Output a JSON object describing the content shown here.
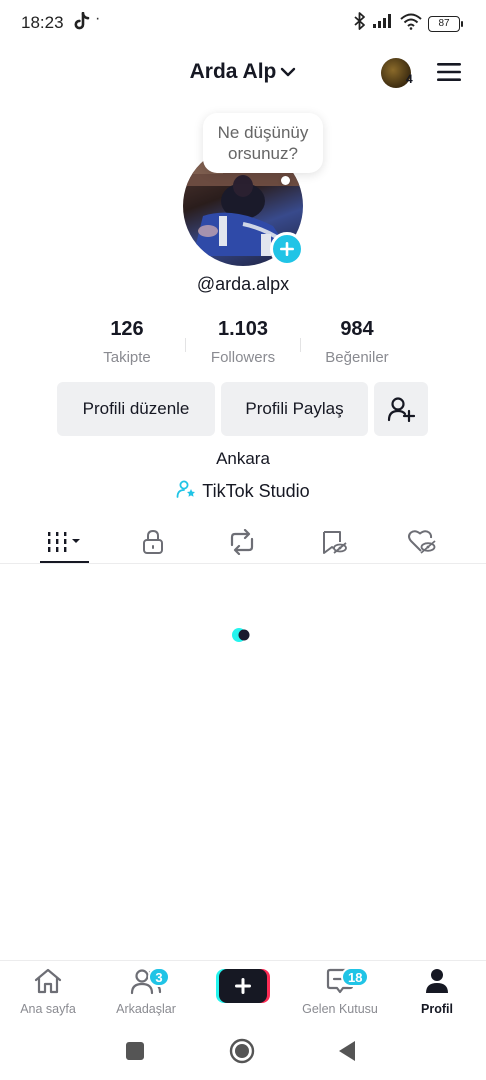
{
  "status_bar": {
    "time": "18:23",
    "dot": "·",
    "battery": "87",
    "icons": [
      "tiktok-icon",
      "bluetooth-icon",
      "signal-icon",
      "wifi-icon",
      "battery-icon"
    ]
  },
  "header": {
    "title": "Arda Alp",
    "account_count": "4",
    "icons": [
      "chevron-down-icon",
      "menu-icon"
    ]
  },
  "profile": {
    "bubble_text_line1": "Ne düşünüy",
    "bubble_text_line2": "orsunuz?",
    "username": "@arda.alpx",
    "stats": [
      {
        "value": "126",
        "label": "Takipte"
      },
      {
        "value": "1.103",
        "label": "Followers"
      },
      {
        "value": "984",
        "label": "Beğeniler"
      }
    ],
    "buttons": {
      "edit": "Profili düzenle",
      "share": "Profili Paylaş"
    },
    "location": "Ankara",
    "studio": "TikTok Studio"
  },
  "tabs": [
    "videos-grid-icon",
    "lock-icon",
    "repost-icon",
    "favorites-icon",
    "liked-icon"
  ],
  "bottom_nav": [
    {
      "label": "Ana sayfa",
      "icon": "home-icon"
    },
    {
      "label": "Arkadaşlar",
      "icon": "friends-icon",
      "badge": "3"
    },
    {
      "label": "",
      "icon": "plus-icon"
    },
    {
      "label": "Gelen Kutusu",
      "icon": "inbox-icon",
      "badge": "18"
    },
    {
      "label": "Profil",
      "icon": "profile-icon"
    }
  ],
  "colors": {
    "accent": "#20c4e6",
    "brand_red": "#fe2c55",
    "text": "#161823",
    "muted": "#8a8b91",
    "button_bg": "#eff0f2"
  }
}
